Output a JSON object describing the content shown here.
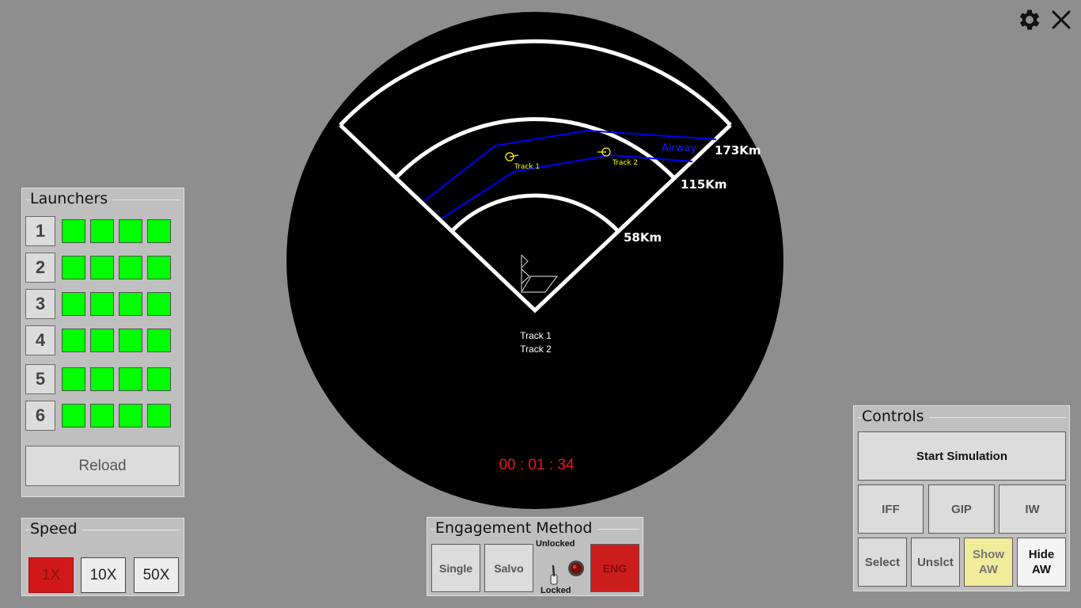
{
  "top_icons": {
    "settings": "gear-icon",
    "close": "close-icon"
  },
  "radar": {
    "ranges": [
      "58Km",
      "115Km",
      "173Km"
    ],
    "airway_label": "Airway",
    "tracks": [
      {
        "label": "Track 1"
      },
      {
        "label": "Track 2"
      }
    ],
    "track_list": [
      "Track 1",
      "Track 2"
    ],
    "timer": "00 : 01 : 34",
    "colors": {
      "background": "#000000",
      "sector": "#ffffff",
      "airway": "#0000ff",
      "track": "#ffff00",
      "timer": "#e41b1b"
    }
  },
  "launchers": {
    "title": "Launchers",
    "rows": [
      {
        "label": "1",
        "cells": 4
      },
      {
        "label": "2",
        "cells": 4
      },
      {
        "label": "3",
        "cells": 4
      },
      {
        "label": "4",
        "cells": 4
      },
      {
        "label": "5",
        "cells": 4
      },
      {
        "label": "6",
        "cells": 4
      }
    ],
    "cell_color": "#00ff00",
    "reload_label": "Reload"
  },
  "speed": {
    "title": "Speed",
    "options": [
      "1X",
      "10X",
      "50X"
    ],
    "selected": "1X"
  },
  "engagement": {
    "title": "Engagement Method",
    "single_label": "Single",
    "salvo_label": "Salvo",
    "unlocked_label": "Unlocked",
    "locked_label": "Locked",
    "eng_label": "ENG"
  },
  "controls": {
    "title": "Controls",
    "start_label": "Start Simulation",
    "iff_label": "IFF",
    "gip_label": "GIP",
    "iw_label": "IW",
    "select_label": "Select",
    "unselect_label": "Unslct",
    "show_aw_line1": "Show",
    "show_aw_line2": "AW",
    "hide_aw_line1": "Hide",
    "hide_aw_line2": "AW"
  }
}
